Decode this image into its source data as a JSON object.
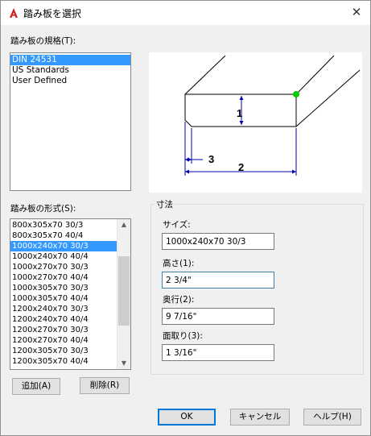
{
  "window": {
    "title": "踏み板を選択",
    "close_glyph": "✕"
  },
  "spec": {
    "label": "踏み板の規格(T):",
    "items": [
      "DIN 24531",
      "US Standards",
      "User Defined"
    ],
    "selected_index": 0
  },
  "format": {
    "label": "踏み板の形式(S):",
    "items": [
      "800x305x70 30/3",
      "800x305x70 40/4",
      "1000x240x70 30/3",
      "1000x240x70 40/4",
      "1000x270x70 30/3",
      "1000x270x70 40/4",
      "1000x305x70 30/3",
      "1000x305x70 40/4",
      "1200x240x70 30/3",
      "1200x240x70 40/4",
      "1200x270x70 30/3",
      "1200x270x70 40/4",
      "1200x305x70 30/3",
      "1200x305x70 40/4"
    ],
    "selected_index": 2,
    "scroll_fraction": 0.45
  },
  "dimensions": {
    "group_title": "寸法",
    "size_label": "サイズ:",
    "size_value": "1000x240x70 30/3",
    "height_label": "高さ(1):",
    "height_value": "2 3/4\"",
    "depth_label": "奥行(2):",
    "depth_value": "9 7/16\"",
    "chamfer_label": "面取り(3):",
    "chamfer_value": "1 3/16\""
  },
  "diagram": {
    "label_height": "1",
    "label_depth": "2",
    "label_chamfer": "3",
    "outline_color": "#000000",
    "dimension_color": "#0000b4",
    "marker_color": "#00cc00"
  },
  "buttons": {
    "add": "追加(A)",
    "delete": "削除(R)",
    "ok": "OK",
    "cancel": "キャンセル",
    "help": "ヘルプ(H)"
  },
  "accent": "#3399ff"
}
